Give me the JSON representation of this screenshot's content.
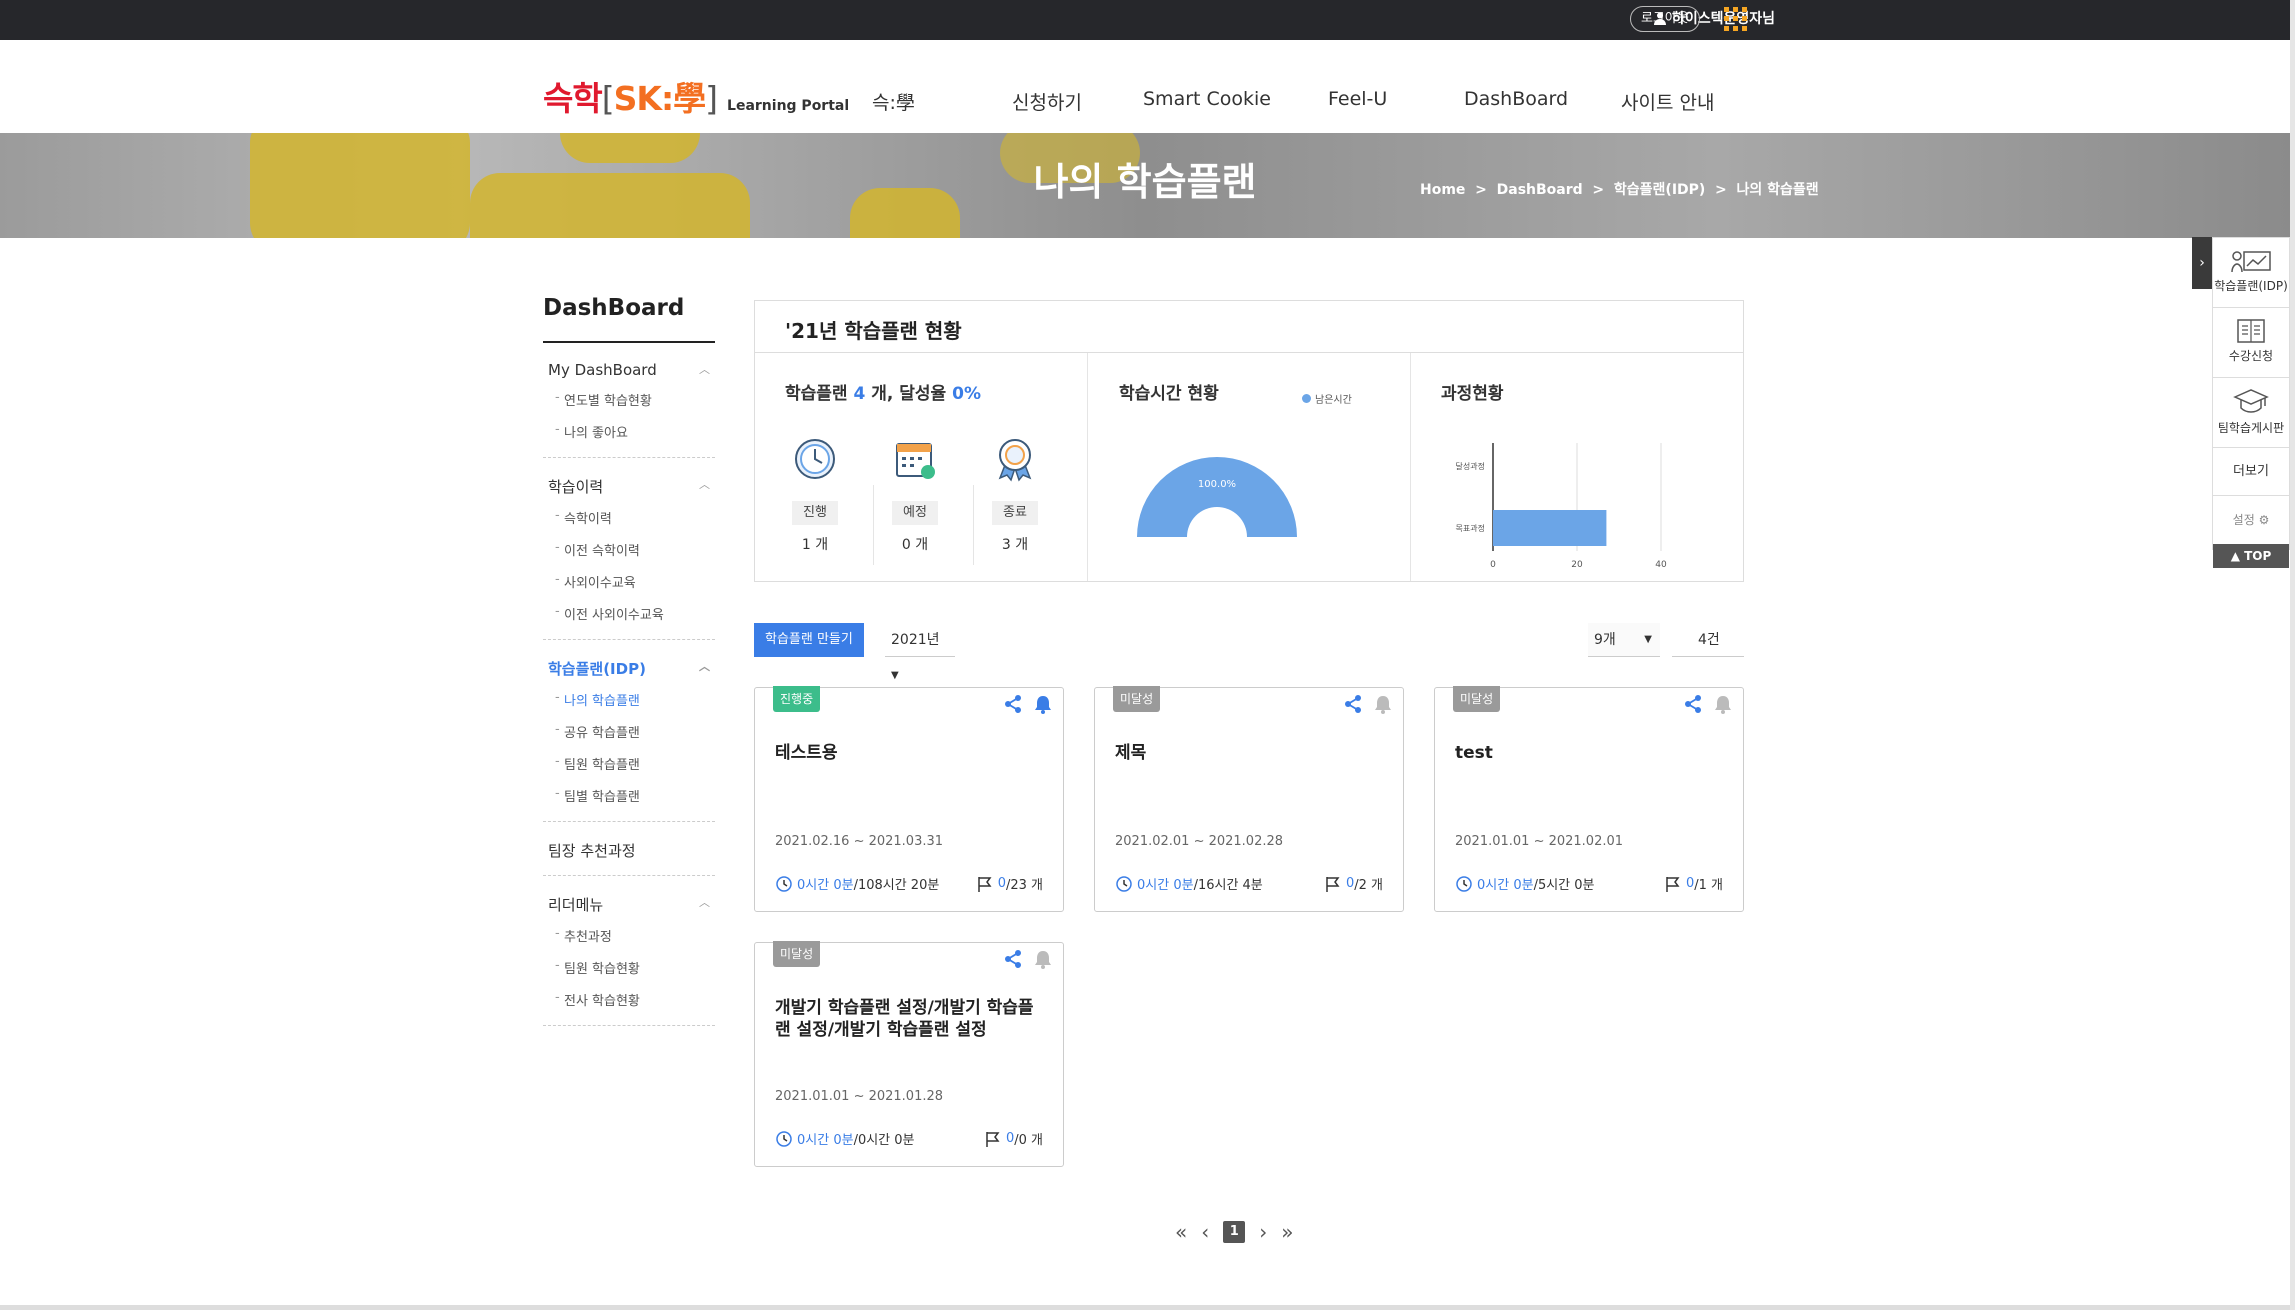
{
  "topbar": {
    "user": "하이스텍운영자님",
    "logout": "로그아웃"
  },
  "logo": {
    "k1": "슥학",
    "b1": "[",
    "sk": "SK:學",
    "b2": "]",
    "sub": "Learning Portal"
  },
  "nav": [
    "슥:學",
    "신청하기",
    "Smart Cookie",
    "Feel-U",
    "DashBoard",
    "사이트 안내"
  ],
  "hero": {
    "title": "나의 학습플랜",
    "breadcrumb": "Home  >  DashBoard  >  학습플랜(IDP)  >  나의 학습플랜"
  },
  "sidebar": {
    "title": "DashBoard",
    "groups": [
      {
        "label": "My DashBoard",
        "items": [
          "연도별 학습현황",
          "나의 좋아요"
        ]
      },
      {
        "label": "학습이력",
        "items": [
          "슥학이력",
          "이전 슥학이력",
          "사외이수교육",
          "이전 사외이수교육"
        ]
      },
      {
        "label": "학습플랜(IDP)",
        "items": [
          "나의 학습플랜",
          "공유 학습플랜",
          "팀원 학습플랜",
          "팀별 학습플랜"
        ]
      },
      {
        "label": "팀장 추천과정",
        "items": []
      },
      {
        "label": "리더메뉴",
        "items": [
          "추천과정",
          "팀원 학습현황",
          "전사 학습현황"
        ]
      }
    ]
  },
  "status": {
    "title": "'21년 학습플랜 현황",
    "plan_prefix": "학습플랜",
    "plan_count": "4",
    "plan_mid": "개, 달성율",
    "plan_rate": "0%",
    "items": [
      {
        "label": "진행",
        "count": "1 개"
      },
      {
        "label": "예정",
        "count": "0 개"
      },
      {
        "label": "종료",
        "count": "3 개"
      }
    ],
    "time_title": "학습시간 현황",
    "time_legend": "남은시간",
    "time_pct": "100.0%",
    "course_title": "과정현황"
  },
  "chart_data": {
    "type": "bar",
    "categories": [
      "달성과정",
      "목표과정"
    ],
    "values": [
      0,
      27
    ],
    "xlim": [
      0,
      40
    ],
    "xticks": [
      "0",
      "20",
      "40"
    ],
    "orientation": "horizontal",
    "color": "#6ba5e7"
  },
  "controls": {
    "create": "학습플랜 만들기",
    "year": "2021년",
    "per_page": "9개",
    "total": "4건"
  },
  "cards": [
    {
      "badge": "진행중",
      "badge_color": "#3cbd8b",
      "title": "테스트용",
      "date": "2021.02.16 ~ 2021.03.31",
      "time_done": "0시간 0분",
      "time_total": "/108시간 20분",
      "prog_done": "0",
      "prog_total": "/23 개"
    },
    {
      "badge": "미달성",
      "badge_color": "#9a9a9a",
      "title": "제목",
      "date": "2021.02.01 ~ 2021.02.28",
      "time_done": "0시간 0분",
      "time_total": "/16시간 4분",
      "prog_done": "0",
      "prog_total": "/2 개"
    },
    {
      "badge": "미달성",
      "badge_color": "#9a9a9a",
      "title": "test",
      "date": "2021.01.01 ~ 2021.02.01",
      "time_done": "0시간 0분",
      "time_total": "/5시간 0분",
      "prog_done": "0",
      "prog_total": "/1 개"
    },
    {
      "badge": "미달성",
      "badge_color": "#9a9a9a",
      "title": "개발기 학습플랜 설정/개발기 학습플랜 설정/개발기 학습플랜 설정",
      "date": "2021.01.01 ~ 2021.01.28",
      "time_done": "0시간 0분",
      "time_total": "/0시간 0분",
      "prog_done": "0",
      "prog_total": "/0 개"
    }
  ],
  "pagination": {
    "current": "1"
  },
  "quickmenu": {
    "items": [
      "학습플랜(IDP)",
      "수강신청",
      "팀학습게시판"
    ],
    "more": "더보기",
    "settings": "설정",
    "top": "▲ TOP"
  },
  "colors": {
    "accent": "#3a7de6",
    "topbar": "#26272b",
    "brand_red": "#e0192e",
    "brand_orange": "#f36f21"
  }
}
